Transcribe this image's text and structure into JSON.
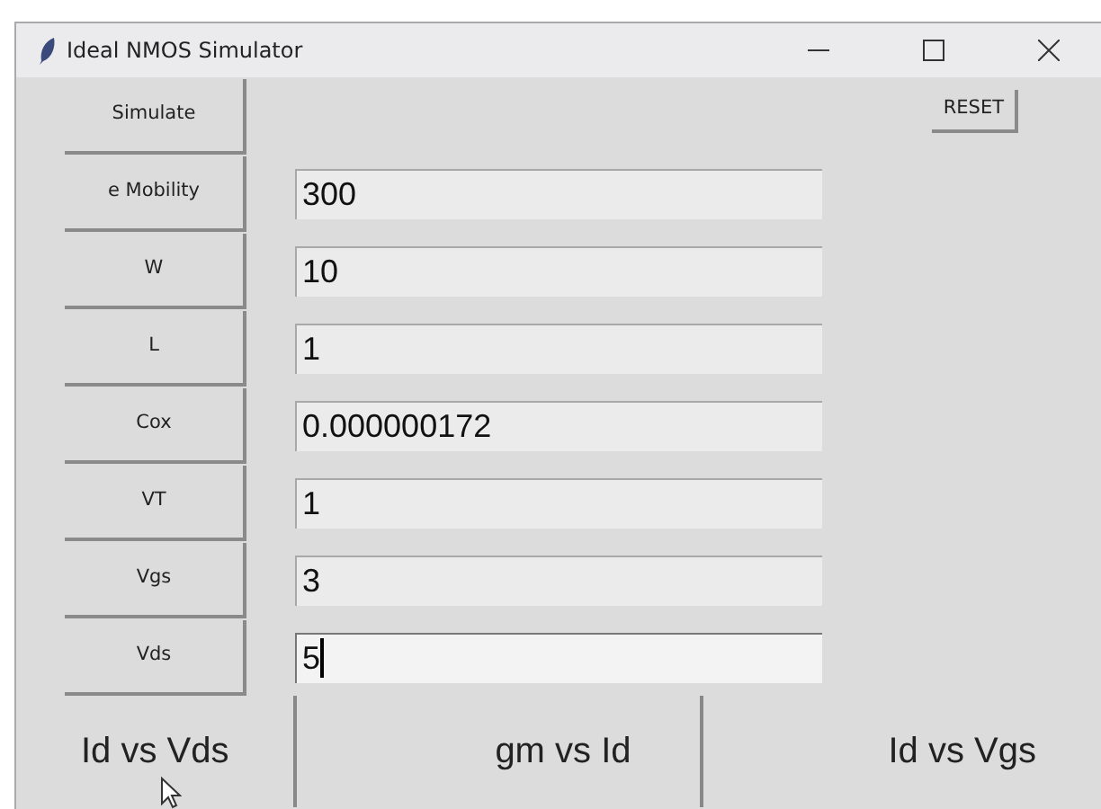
{
  "window": {
    "title": "Ideal NMOS Simulator"
  },
  "simulate_button": "Simulate",
  "reset_button": "RESET",
  "parameters": [
    {
      "label": "e Mobility",
      "value": "300",
      "focused": false
    },
    {
      "label": "W",
      "value": "10",
      "focused": false
    },
    {
      "label": "L",
      "value": "1",
      "focused": false
    },
    {
      "label": "Cox",
      "value": "0.000000172",
      "focused": false
    },
    {
      "label": "VT",
      "value": "1",
      "focused": false
    },
    {
      "label": "Vgs",
      "value": "3",
      "focused": false
    },
    {
      "label": "Vds",
      "value": "5",
      "focused": true
    }
  ],
  "plot_buttons": [
    "Id vs Vds",
    "gm vs Id",
    "Id vs Vgs"
  ]
}
